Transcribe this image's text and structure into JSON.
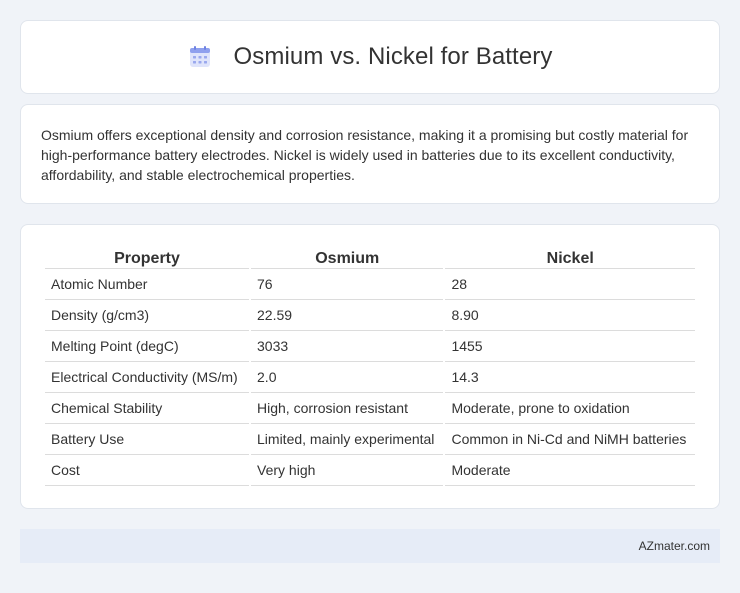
{
  "header": {
    "title": "Osmium vs. Nickel for Battery",
    "icon": "calendar-icon",
    "icon_color": "#7b8de8"
  },
  "intro": {
    "text": "Osmium offers exceptional density and corrosion resistance, making it a promising but costly material for high-performance battery electrodes. Nickel is widely used in batteries due to its excellent conductivity, affordability, and stable electrochemical properties."
  },
  "table": {
    "headers": [
      "Property",
      "Osmium",
      "Nickel"
    ],
    "rows": [
      [
        "Atomic Number",
        "76",
        "28"
      ],
      [
        "Density (g/cm3)",
        "22.59",
        "8.90"
      ],
      [
        "Melting Point (degC)",
        "3033",
        "1455"
      ],
      [
        "Electrical Conductivity (MS/m)",
        "2.0",
        "14.3"
      ],
      [
        "Chemical Stability",
        "High, corrosion resistant",
        "Moderate, prone to oxidation"
      ],
      [
        "Battery Use",
        "Limited, mainly experimental",
        "Common in Ni-Cd and NiMH batteries"
      ],
      [
        "Cost",
        "Very high",
        "Moderate"
      ]
    ]
  },
  "footer": {
    "site": "AZmater.com"
  }
}
